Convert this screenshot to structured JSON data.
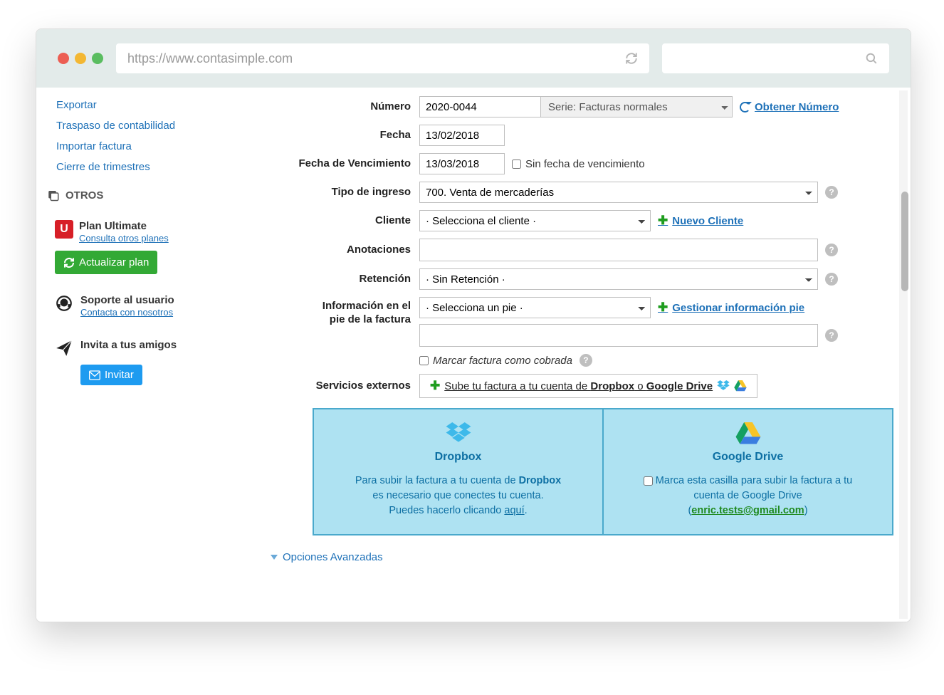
{
  "browser": {
    "url": "https://www.contasimple.com"
  },
  "nav": {
    "exportar": "Exportar",
    "traspaso": "Traspaso de contabilidad",
    "importar": "Importar factura",
    "cierre": "Cierre de trimestres"
  },
  "section_otros": "OTROS",
  "plan": {
    "badge": "U",
    "title": "Plan Ultimate",
    "link": "Consulta otros planes",
    "button": "Actualizar plan"
  },
  "support": {
    "title": "Soporte al usuario",
    "link": "Contacta con nosotros"
  },
  "invite": {
    "title": "Invita a tus amigos",
    "button": "Invitar"
  },
  "labels": {
    "numero": "Número",
    "fecha": "Fecha",
    "venc": "Fecha de Vencimiento",
    "tipo": "Tipo de ingreso",
    "cliente": "Cliente",
    "anot": "Anotaciones",
    "ret": "Retención",
    "pie1": "Información en el",
    "pie2": "pie de la factura",
    "serv": "Servicios externos"
  },
  "values": {
    "numero": "2020-0044",
    "serie": "Serie: Facturas normales",
    "fecha": "13/02/2018",
    "venc": "13/03/2018",
    "tipo": "700. Venta de mercaderías",
    "cliente": "· Selecciona el cliente ·",
    "ret": "· Sin Retención ·",
    "pie_sel": "· Selecciona un pie ·"
  },
  "actions": {
    "obtener": "Obtener Número",
    "nuevo_cliente": "Nuevo Cliente",
    "gest_pie": "Gestionar información pie"
  },
  "checks": {
    "sin_venc": "Sin fecha de vencimiento",
    "cobrada": "Marcar factura como cobrada"
  },
  "ext_services": {
    "pre": "Sube tu factura a tu cuenta de ",
    "dbx": "Dropbox",
    "o": " o ",
    "gdr": "Google Drive "
  },
  "dropbox": {
    "title": "Dropbox",
    "l1a": "Para subir la factura a tu cuenta de ",
    "l1b": "Dropbox",
    "l2": "es necesario que conectes tu cuenta.",
    "l3a": "Puedes hacerlo clicando ",
    "l3b": "aquí",
    "l3c": "."
  },
  "gdrive": {
    "title": "Google Drive",
    "l1": "Marca esta casilla para subir la factura a tu",
    "l2": "cuenta de Google Drive",
    "email": "enric.tests@gmail.com"
  },
  "advanced": "Opciones Avanzadas"
}
